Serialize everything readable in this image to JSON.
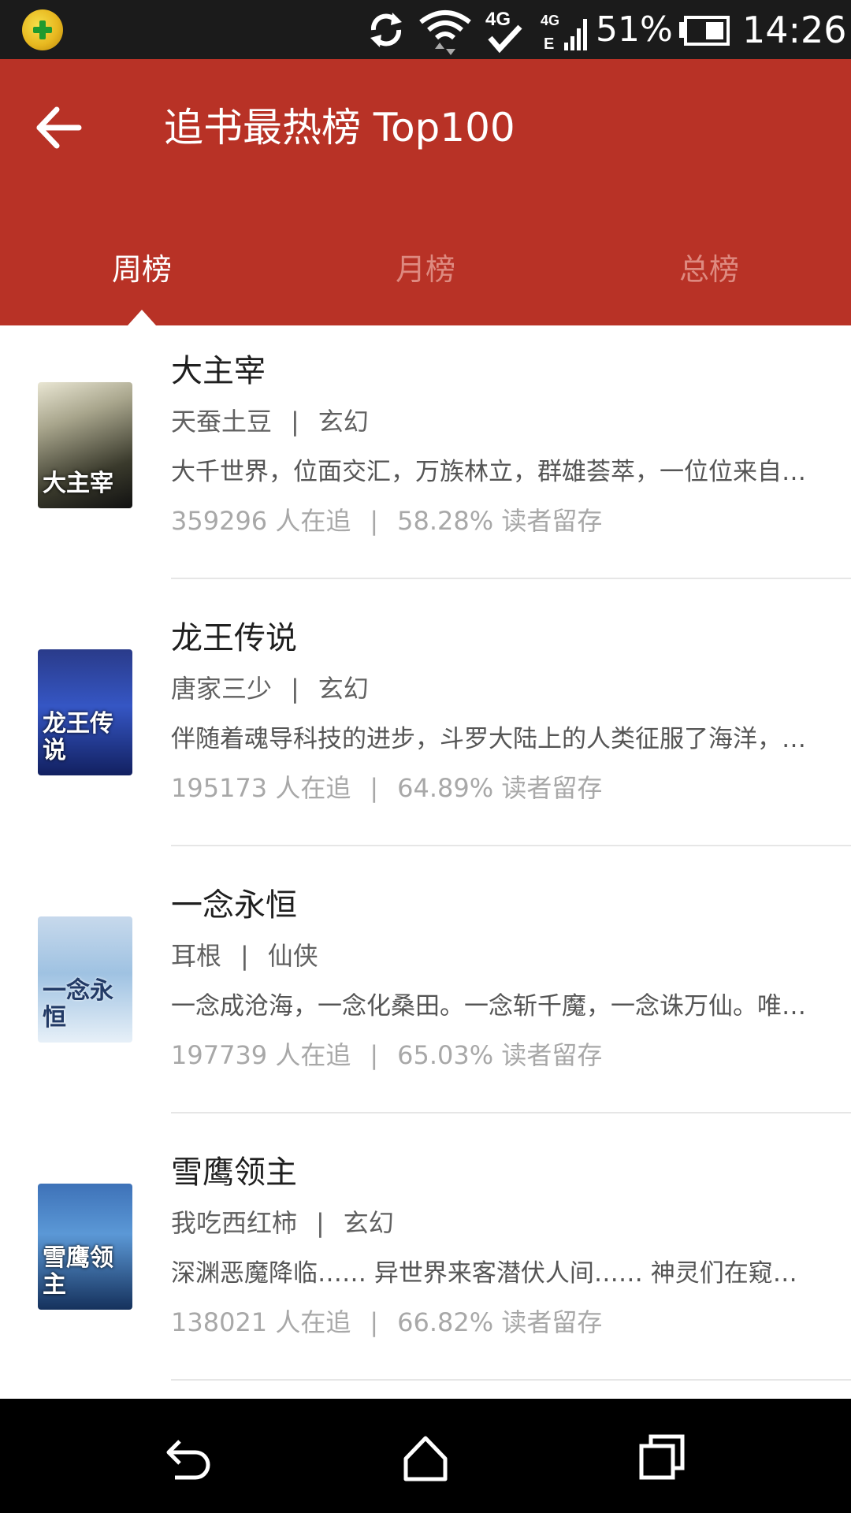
{
  "status_bar": {
    "app_icon": "360-security-icon",
    "icons": [
      "sync-icon",
      "wifi-icon",
      "4g-icon",
      "signal-icon"
    ],
    "network_label": "4G",
    "signal_labels": [
      "4G",
      "E"
    ],
    "battery_percent": "51%",
    "time": "14:26"
  },
  "header": {
    "back_icon": "arrow-left-icon",
    "title": "追书最热榜 Top100",
    "background_color": "#b83226"
  },
  "tabs": [
    {
      "label": "周榜",
      "active": true
    },
    {
      "label": "月榜",
      "active": false
    },
    {
      "label": "总榜",
      "active": false
    }
  ],
  "books": [
    {
      "title": "大主宰",
      "author": "天蚕土豆",
      "category": "玄幻",
      "description": "大千世界，位面交汇，万族林立，群雄荟萃，一位位来自下位面的天之至尊",
      "followers": "359296 人在追",
      "retention": "58.28% 读者留存",
      "cover_text": "大主宰"
    },
    {
      "title": "龙王传说",
      "author": "唐家三少",
      "category": "玄幻",
      "description": "伴随着魂导科技的进步，斗罗大陆上的人类征服了海洋，又发现了两片大陆",
      "followers": "195173 人在追",
      "retention": "64.89% 读者留存",
      "cover_text": "龙王传说"
    },
    {
      "title": "一念永恒",
      "author": "耳根",
      "category": "仙侠",
      "description": "一念成沧海，一念化桑田。一念斩千魔，一念诛万仙。唯我念……永恒",
      "followers": "197739 人在追",
      "retention": "65.03% 读者留存",
      "cover_text": "一念永恒"
    },
    {
      "title": "雪鹰领主",
      "author": "我吃西红柿",
      "category": "玄幻",
      "description": "深渊恶魔降临…… 异世界来客潜伏人间…… 神灵们在窥视……",
      "followers": "138021 人在追",
      "retention": "66.82% 读者留存",
      "cover_text": "雪鹰领主"
    }
  ],
  "separator": "|",
  "nav_bar": {
    "icons": [
      "back-icon",
      "home-icon",
      "recent-apps-icon"
    ]
  }
}
